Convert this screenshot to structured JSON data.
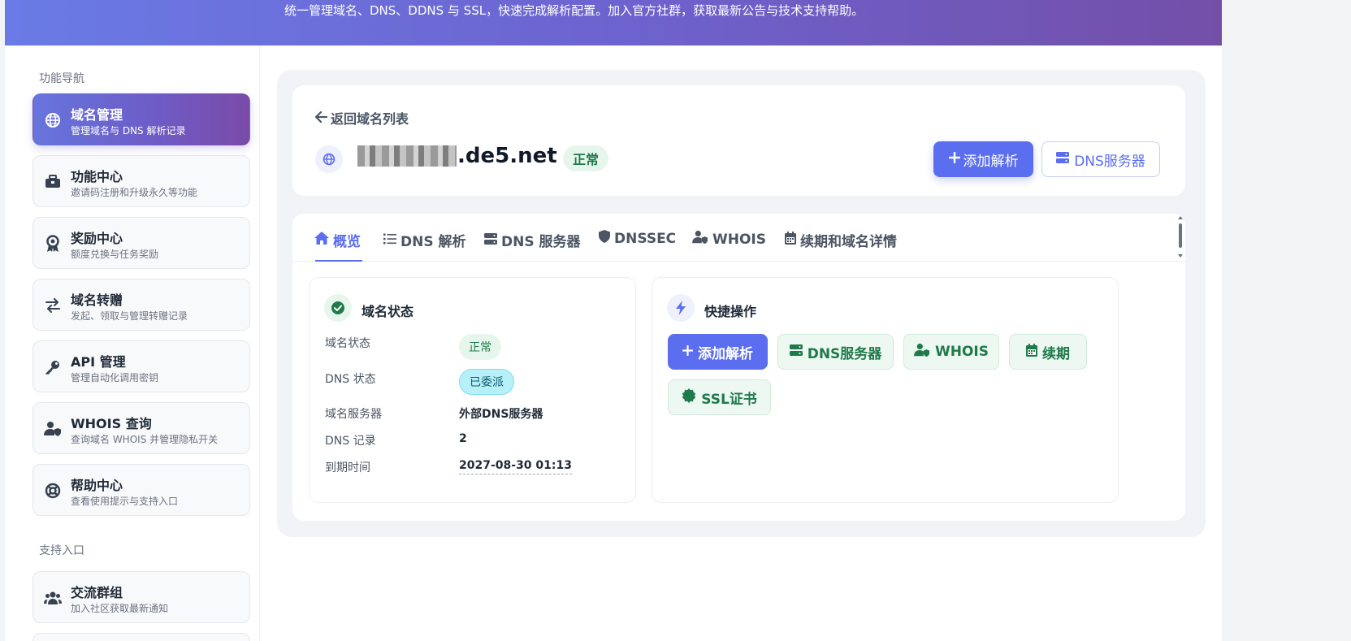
{
  "banner": {
    "text": "统一管理域名、DNS、DDNS 与 SSL，快速完成解析配置。加入官方社群，获取最新公告与技术支持帮助。"
  },
  "sidebar": {
    "section_nav": "功能导航",
    "section_support": "支持入口",
    "items": [
      {
        "title": "域名管理",
        "subtitle": "管理域名与 DNS 解析记录",
        "icon": "globe-icon"
      },
      {
        "title": "功能中心",
        "subtitle": "邀请码注册和升级永久等功能",
        "icon": "toolbox-icon"
      },
      {
        "title": "奖励中心",
        "subtitle": "额度兑换与任务奖励",
        "icon": "award-icon"
      },
      {
        "title": "域名转赠",
        "subtitle": "发起、领取与管理转赠记录",
        "icon": "transfer-icon"
      },
      {
        "title": "API 管理",
        "subtitle": "管理自动化调用密钥",
        "icon": "key-icon"
      },
      {
        "title": "WHOIS 查询",
        "subtitle": "查询域名 WHOIS 并管理隐私开关",
        "icon": "user-shield-icon"
      },
      {
        "title": "帮助中心",
        "subtitle": "查看使用提示与支持入口",
        "icon": "lifebuoy-icon"
      }
    ],
    "support_items": [
      {
        "title": "交流群组",
        "subtitle": "加入社区获取最新通知",
        "icon": "users-icon"
      }
    ]
  },
  "header": {
    "back_label": "返回域名列表",
    "domain_suffix": ".de5.net",
    "status": "正常",
    "add_record_label": "添加解析",
    "dns_server_label": "DNS服务器"
  },
  "tabs": [
    {
      "label": "概览",
      "icon": "home-icon"
    },
    {
      "label": "DNS 解析",
      "icon": "list-icon"
    },
    {
      "label": "DNS 服务器",
      "icon": "server-icon"
    },
    {
      "label": "DNSSEC",
      "icon": "shield-icon"
    },
    {
      "label": "WHOIS",
      "icon": "user-shield-icon"
    },
    {
      "label": "续期和域名详情",
      "icon": "calendar-icon"
    }
  ],
  "status_panel": {
    "title": "域名状态",
    "rows": [
      {
        "label": "域名状态",
        "value": "正常"
      },
      {
        "label": "DNS 状态",
        "value": "已委派"
      },
      {
        "label": "域名服务器",
        "value": "外部DNS服务器"
      },
      {
        "label": "DNS 记录",
        "value": "2"
      },
      {
        "label": "到期时间",
        "value": "2027-08-30 01:13"
      }
    ]
  },
  "quick_panel": {
    "title": "快捷操作",
    "buttons": [
      {
        "label": "添加解析",
        "icon": "plus-icon"
      },
      {
        "label": "DNS服务器",
        "icon": "server-icon"
      },
      {
        "label": "WHOIS",
        "icon": "user-shield-icon"
      },
      {
        "label": "续期",
        "icon": "calendar-icon"
      },
      {
        "label": "SSL证书",
        "icon": "certificate-icon"
      }
    ]
  },
  "colors": {
    "accent": "#5b6ef0",
    "success": "#1f7a4b",
    "banner_start": "#6a7be6",
    "banner_end": "#734fa8"
  }
}
